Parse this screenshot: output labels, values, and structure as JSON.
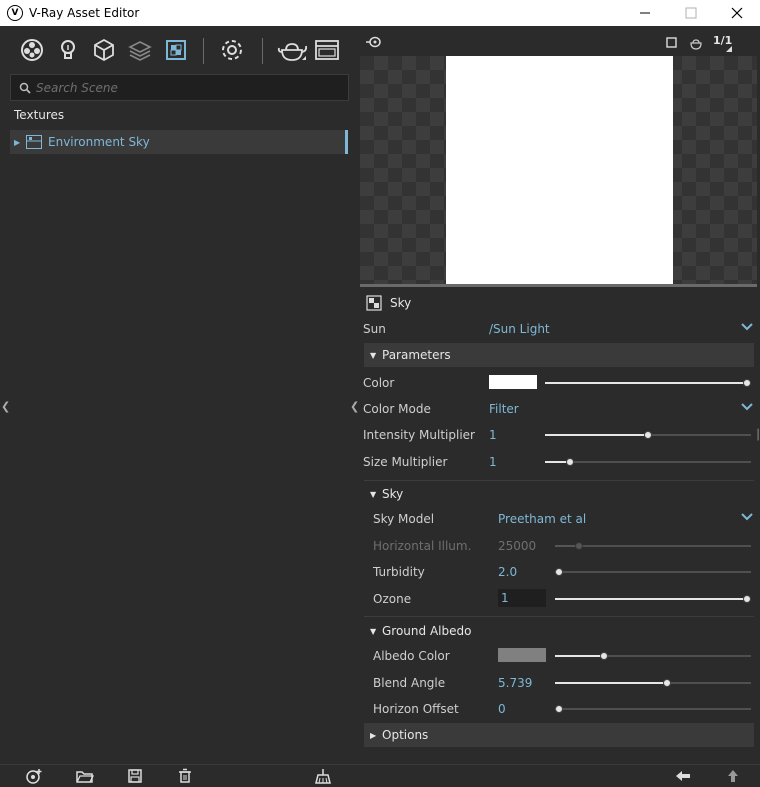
{
  "window": {
    "title": "V-Ray Asset Editor",
    "logo": "V"
  },
  "search": {
    "placeholder": "Search Scene"
  },
  "outliner": {
    "category": "Textures",
    "items": [
      {
        "label": "Environment Sky"
      }
    ]
  },
  "preview": {
    "ratio_label": "1/1"
  },
  "props": {
    "title": "Sky",
    "sun": {
      "label": "Sun",
      "value": "/Sun Light"
    },
    "sections": {
      "parameters": "Parameters",
      "sky": "Sky",
      "ground": "Ground Albedo",
      "options": "Options"
    },
    "color": {
      "label": "Color",
      "swatch": "#ffffff",
      "slider": 1.0
    },
    "color_mode": {
      "label": "Color Mode",
      "value": "Filter"
    },
    "intensity": {
      "label": "Intensity Multiplier",
      "value": "1",
      "slider": 0.5
    },
    "size": {
      "label": "Size Multiplier",
      "value": "1",
      "slider": 0.12
    },
    "sky_model": {
      "label": "Sky Model",
      "value": "Preetham et al"
    },
    "horizontal_illum": {
      "label": "Horizontal Illum.",
      "value": "25000",
      "slider": 0.12
    },
    "turbidity": {
      "label": "Turbidity",
      "value": "2.0",
      "slider": 0.02
    },
    "ozone": {
      "label": "Ozone",
      "value": "1",
      "slider": 1.0
    },
    "albedo_color": {
      "label": "Albedo Color",
      "swatch": "#808080",
      "slider": 0.25
    },
    "blend_angle": {
      "label": "Blend Angle",
      "value": "5.739",
      "slider": 0.57
    },
    "horizon_offset": {
      "label": "Horizon Offset",
      "value": "0",
      "slider": 0.02
    }
  },
  "colors": {
    "accent": "#7fb8d6",
    "panel": "#2b2b2b",
    "section": "#3a3a3a"
  }
}
